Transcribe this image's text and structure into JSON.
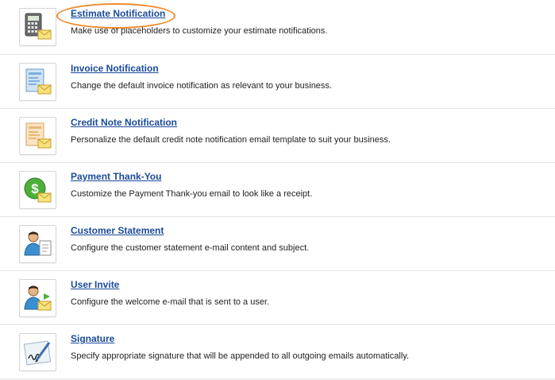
{
  "items": [
    {
      "title": "Estimate Notification",
      "description": "Make use of placeholders to customize your estimate notifications.",
      "icon": "calculator-envelope-icon",
      "highlighted": true
    },
    {
      "title": "Invoice Notification",
      "description": "Change the default invoice notification as relevant to your business.",
      "icon": "invoice-envelope-icon"
    },
    {
      "title": "Credit Note Notification",
      "description": "Personalize the default credit note notification email template to suit your business.",
      "icon": "credit-note-envelope-icon"
    },
    {
      "title": "Payment Thank-You",
      "description": "Customize the Payment Thank-you email to look like a receipt.",
      "icon": "dollar-envelope-icon"
    },
    {
      "title": "Customer Statement",
      "description": "Configure the customer statement e-mail content and subject.",
      "icon": "customer-document-icon"
    },
    {
      "title": "User Invite",
      "description": "Configure the welcome e-mail that is sent to a user.",
      "icon": "user-envelope-icon"
    },
    {
      "title": "Signature",
      "description": "Specify appropriate signature that will be appended to all outgoing emails automatically.",
      "icon": "signature-pen-icon"
    }
  ],
  "colors": {
    "link": "#1a4a9c",
    "highlight_ring": "#ef8a2c",
    "divider": "#e3e3e3"
  }
}
